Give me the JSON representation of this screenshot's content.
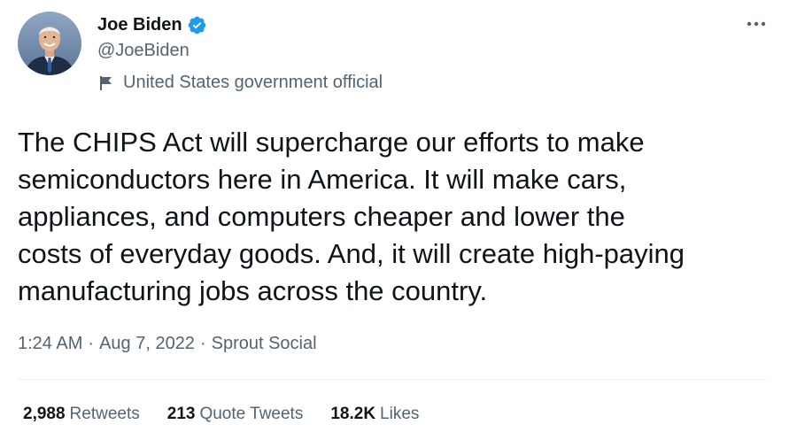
{
  "author": {
    "name": "Joe Biden",
    "handle": "@JoeBiden",
    "label": "United States government official",
    "verified_color": "#1d9bf0"
  },
  "tweet": {
    "text": "The CHIPS Act will supercharge our efforts to make\nsemiconductors here in America. It will make cars,\nappliances, and computers cheaper and lower the\ncosts of everyday goods. And, it will create high-paying\nmanufacturing jobs across the country.",
    "time": "1:24 AM",
    "date": "Aug 7, 2022",
    "source": "Sprout Social",
    "separator": "·"
  },
  "stats": [
    {
      "count": "2,988",
      "label": "Retweets"
    },
    {
      "count": "213",
      "label": "Quote Tweets"
    },
    {
      "count": "18.2K",
      "label": "Likes"
    }
  ],
  "icons": {
    "verified": "verified-badge-icon",
    "flag": "flag-icon",
    "more": "more-options-icon"
  },
  "colors": {
    "text_primary": "#0f1419",
    "text_secondary": "#536471",
    "accent": "#1d9bf0",
    "divider": "#eff3f4"
  }
}
